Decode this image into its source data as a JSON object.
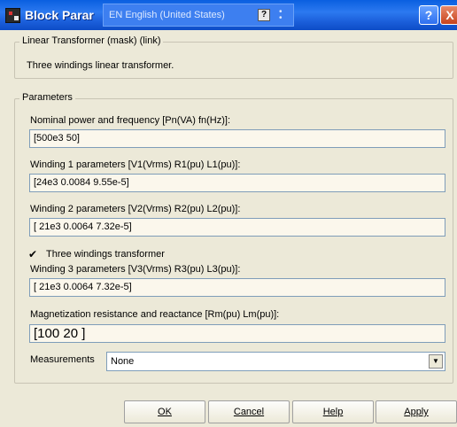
{
  "window": {
    "title": "Block Parar",
    "language_bar": {
      "label": "EN English (United States)",
      "help_glyph": "?",
      "options_glyph": "•\n•"
    },
    "help_button": "?",
    "close_button": "X"
  },
  "mask_group": {
    "label": "Linear Transformer (mask) (link)",
    "description": "Three windings linear transformer."
  },
  "parameters": {
    "label": "Parameters",
    "nominal": {
      "label": "Nominal power and frequency [Pn(VA) fn(Hz)]:",
      "value": "[500e3  50]"
    },
    "winding1": {
      "label": "Winding 1 parameters [V1(Vrms) R1(pu) L1(pu)]:",
      "value": "[24e3  0.0084  9.55e-5]"
    },
    "winding2": {
      "label": "Winding 2 parameters [V2(Vrms) R2(pu) L2(pu)]:",
      "value": "[ 21e3  0.0064  7.32e-5]"
    },
    "three_windings": {
      "label": "Three windings transformer",
      "checked": true
    },
    "winding3": {
      "label": "Winding 3 parameters [V3(Vrms) R3(pu) L3(pu)]:",
      "value": "[ 21e3  0.0064  7.32e-5]"
    },
    "magnetization": {
      "label": "Magnetization resistance and reactance [Rm(pu) Lm(pu)]:",
      "value": "[100   20 ]"
    },
    "measurements": {
      "label": "Measurements",
      "value": "None"
    }
  },
  "buttons": {
    "ok": "OK",
    "cancel": "Cancel",
    "help": "Help",
    "apply": "Apply"
  },
  "colors": {
    "titlebar": "#0a5fe0",
    "dialog_bg": "#ece9d8",
    "field_bg": "#fbf7ec"
  }
}
